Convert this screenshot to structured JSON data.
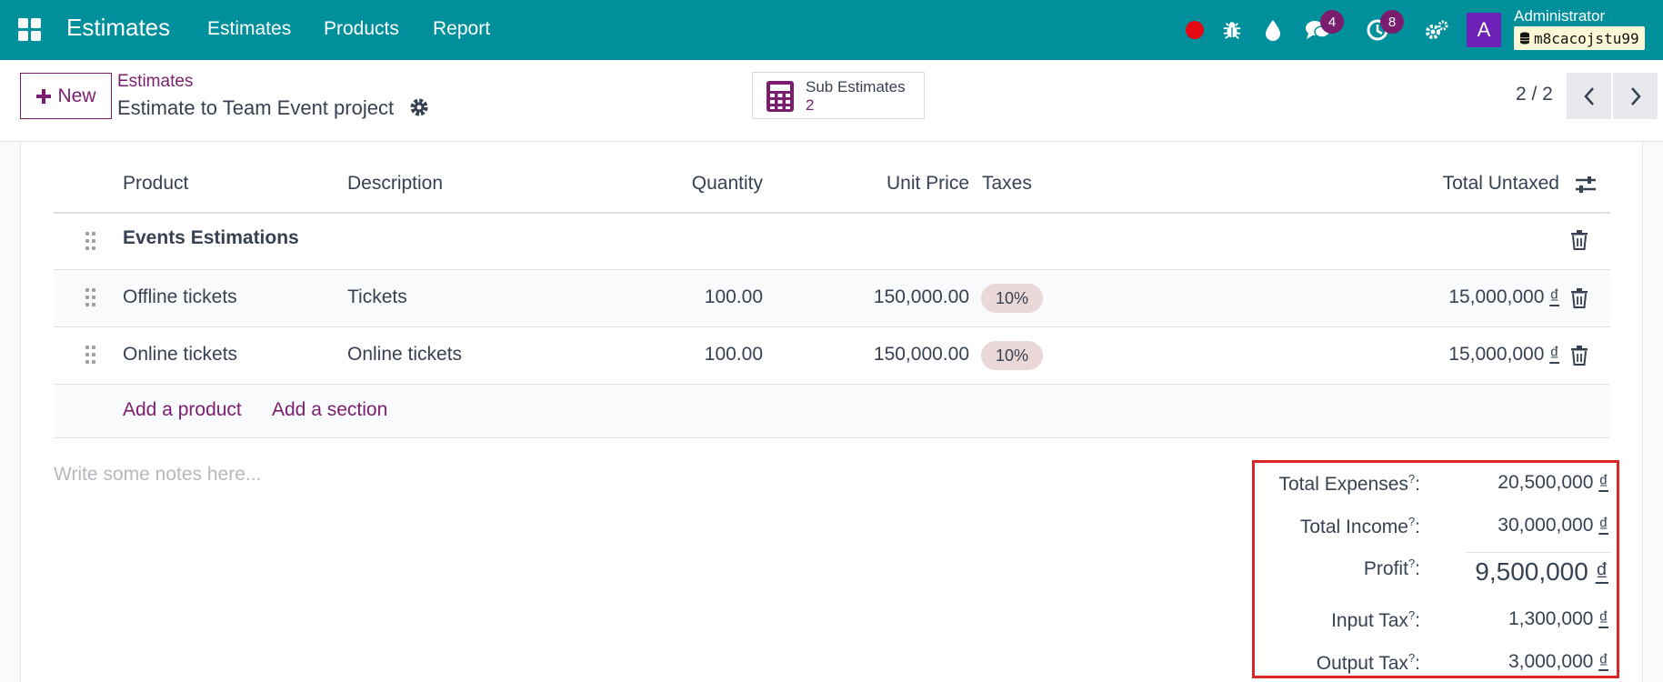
{
  "navbar": {
    "app_name": "Estimates",
    "menu": [
      "Estimates",
      "Products",
      "Report"
    ],
    "messages_count": "4",
    "activities_count": "8",
    "avatar_letter": "A",
    "user_name": "Administrator",
    "database": "m8cacojstu99",
    "color": "#00909c"
  },
  "control": {
    "new_label": "New",
    "breadcrumb": "Estimates",
    "record_title": "Estimate to Team Event project",
    "smart_button": {
      "label": "Sub Estimates",
      "value": "2"
    },
    "pager": "2 / 2"
  },
  "table": {
    "headers": [
      "Product",
      "Description",
      "Quantity",
      "Unit Price",
      "Taxes",
      "Total Untaxed"
    ],
    "section": "Events Estimations",
    "rows": [
      {
        "product": "Offline tickets",
        "description": "Tickets",
        "quantity": "100.00",
        "unit_price": "150,000.00",
        "tax": "10%",
        "total": "15,000,000",
        "currency": "₫"
      },
      {
        "product": "Online tickets",
        "description": "Online tickets",
        "quantity": "100.00",
        "unit_price": "150,000.00",
        "tax": "10%",
        "total": "15,000,000",
        "currency": "₫"
      }
    ],
    "add_product": "Add a product",
    "add_section": "Add a section"
  },
  "notes_placeholder": "Write some notes here...",
  "totals": {
    "help_mark": "?",
    "currency": "₫",
    "items": [
      {
        "label": "Total Expenses",
        "value": "20,500,000"
      },
      {
        "label": "Total Income",
        "value": "30,000,000"
      },
      {
        "label": "Profit",
        "value": "9,500,000"
      },
      {
        "label": "Input Tax",
        "value": "1,300,000"
      },
      {
        "label": "Output Tax",
        "value": "3,000,000"
      }
    ]
  },
  "colors": {
    "accent": "#7b1d6f",
    "highlight_border": "#dc2626"
  }
}
